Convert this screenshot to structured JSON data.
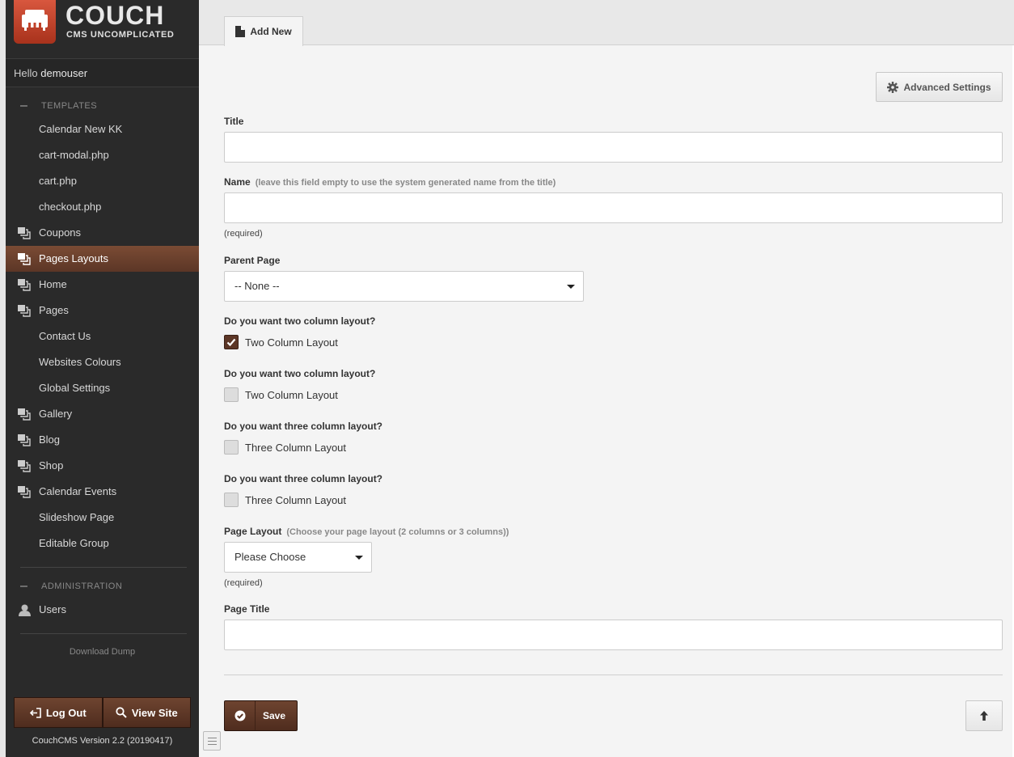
{
  "brand": {
    "name": "COUCH",
    "tagline": "CMS UNCOMPLICATED"
  },
  "greeting": {
    "prefix": "Hello",
    "user": "demouser"
  },
  "sidebar": {
    "templates_heading": "TEMPLATES",
    "items": [
      {
        "label": "Calendar New KK",
        "icon": "none"
      },
      {
        "label": "cart-modal.php",
        "icon": "none"
      },
      {
        "label": "cart.php",
        "icon": "none"
      },
      {
        "label": "checkout.php",
        "icon": "none"
      },
      {
        "label": "Coupons",
        "icon": "pages-icon"
      },
      {
        "label": "Pages Layouts",
        "icon": "pages-icon",
        "active": true
      },
      {
        "label": "Home",
        "icon": "pages-icon"
      },
      {
        "label": "Pages",
        "icon": "pages-icon"
      },
      {
        "label": "Contact Us",
        "icon": "none"
      },
      {
        "label": "Websites Colours",
        "icon": "none"
      },
      {
        "label": "Global Settings",
        "icon": "none"
      },
      {
        "label": "Gallery",
        "icon": "pages-icon"
      },
      {
        "label": "Blog",
        "icon": "pages-icon"
      },
      {
        "label": "Shop",
        "icon": "pages-icon"
      },
      {
        "label": "Calendar Events",
        "icon": "pages-icon"
      },
      {
        "label": "Slideshow Page",
        "icon": "none"
      },
      {
        "label": "Editable Group",
        "icon": "none"
      }
    ],
    "admin_heading": "ADMINISTRATION",
    "admin_items": [
      {
        "label": "Users",
        "icon": "user-icon"
      }
    ],
    "download": "Download Dump",
    "logout": "Log Out",
    "view_site": "View Site",
    "version": "CouchCMS Version 2.2 (20190417)"
  },
  "tab": {
    "label": "Add New"
  },
  "advanced": {
    "label": "Advanced Settings"
  },
  "form": {
    "title_label": "Title",
    "name_label": "Name",
    "name_hint": "(leave this field empty to use the system generated name from the title)",
    "required": "(required)",
    "parent_label": "Parent Page",
    "parent_value": "-- None --",
    "q1": "Do you want two column layout?",
    "cb1": {
      "label": "Two Column Layout",
      "checked": true
    },
    "q2": "Do you want two column layout?",
    "cb2": {
      "label": "Two Column Layout",
      "checked": false
    },
    "q3": "Do you want three column layout?",
    "cb3": {
      "label": "Three Column Layout",
      "checked": false
    },
    "q4": "Do you want three column layout?",
    "cb4": {
      "label": "Three Column Layout",
      "checked": false
    },
    "layout_label": "Page Layout",
    "layout_hint": "(Choose your page layout (2 columns or 3 columns))",
    "layout_value": "Please Choose",
    "page_title_label": "Page Title",
    "save": "Save"
  },
  "colors": {
    "accent": "#5c3626",
    "sidebar": "#2a2a2a"
  }
}
